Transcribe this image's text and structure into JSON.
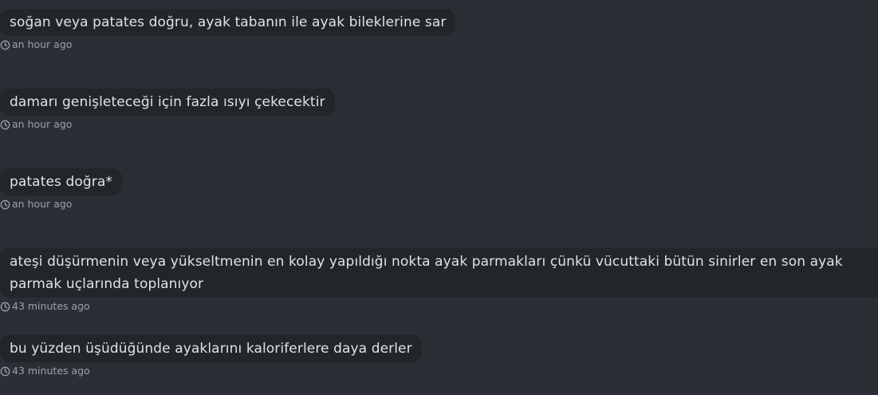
{
  "messages": [
    {
      "text": "soğan veya patates doğru, ayak tabanın ile ayak bileklerine sar",
      "time": "an hour ago"
    },
    {
      "text": "damarı genişleteceği için fazla ısıyı çekecektir",
      "time": "an hour ago"
    },
    {
      "text": "patates doğra*",
      "time": "an hour ago"
    },
    {
      "text": "ateşi düşürmenin veya yükseltmenin en kolay yapıldığı nokta ayak parmakları çünkü vücuttaki bütün sinirler en son ayak parmak uçlarında toplanıyor",
      "time": "43 minutes ago"
    },
    {
      "text": "bu yüzden üşüdüğünde ayaklarını kaloriferlere daya derler",
      "time": "43 minutes ago"
    }
  ],
  "icons": {
    "timestamp": "clock-icon"
  },
  "colors": {
    "background": "#2b2f35",
    "bubble": "#22262b",
    "text": "#dfe3e8",
    "meta": "#9aa1a9"
  }
}
